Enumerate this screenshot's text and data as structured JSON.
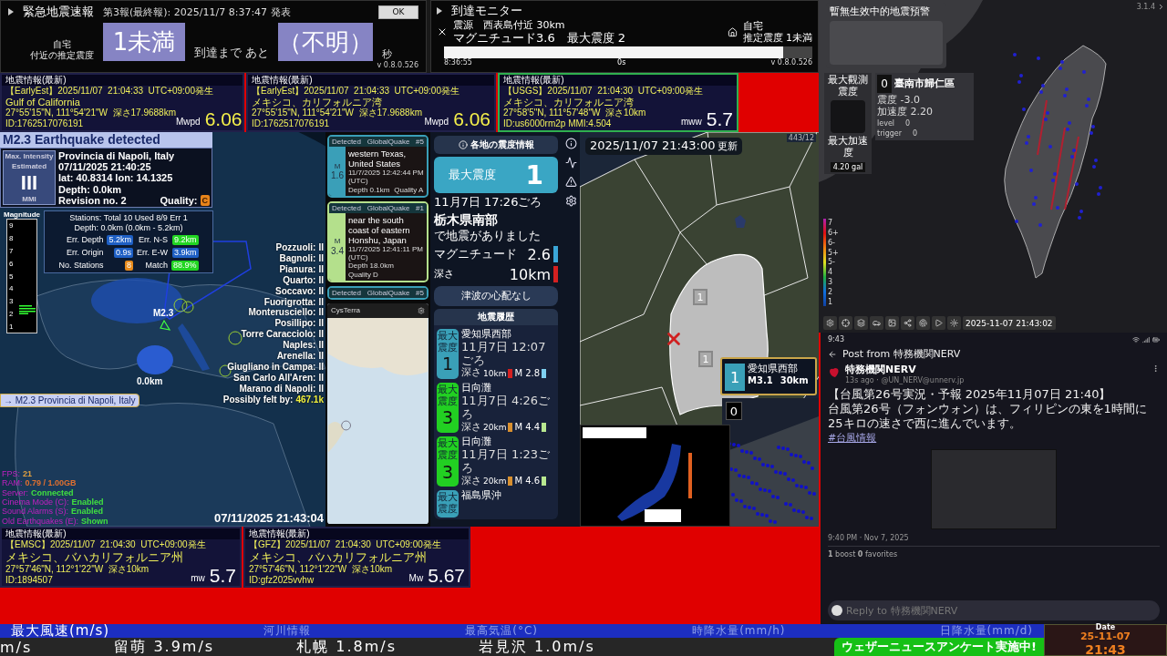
{
  "eew": {
    "title": "緊急地震速報",
    "report": "第3報(最終報): 2025/11/7 8:37:47 発表",
    "ok": "OK",
    "location": [
      "自宅",
      "付近の推定震度"
    ],
    "intensity": "1未満",
    "until": "到達まで あと",
    "seconds": "（不明）",
    "unit": "秒",
    "version": "v 0.8.0.526"
  },
  "monitor": {
    "title": "到達モニター",
    "epicenter": "震源　西表島付近 30km",
    "magnitude": "マグニチュード3.6　最大震度 2",
    "home": "自宅",
    "home_intensity": "推定震度 1未満",
    "countdown": "0s",
    "level": 0.92,
    "time": "8:36:55",
    "version": "v 0.8.0.526"
  },
  "quake_cards": [
    {
      "heading": "地震情報(最新)",
      "source": "【EarlyEst】2025/11/07  21:04:33  UTC+09:00発生",
      "region": "Gulf of California",
      "coords": "27°55'15\"N, 111°54'21\"W  深さ17.9688km",
      "id": "ID:1762517076191",
      "mag_type": "Mwpd",
      "mag": "6.06",
      "color": "#f5f04a",
      "highlighted": false
    },
    {
      "heading": "地震情報(最新)",
      "source": "【EarlyEst】2025/11/07  21:04:33  UTC+09:00発生",
      "region": "メキシコ、カリフォルニア湾",
      "coords": "27°55'15\"N, 111°54'21\"W  深さ17.9688km",
      "id": "ID:1762517076191",
      "mag_type": "Mwpd",
      "mag": "6.06",
      "color": "#f5f04a",
      "highlighted": false
    },
    {
      "heading": "地震情報(最新)",
      "source": "【USGS】2025/11/07  21:04:30  UTC+09:00発生",
      "region": "メキシコ、カリフォルニア湾",
      "coords": "27°58'5\"N, 111°57'48\"W  深さ10km",
      "id": "ID:us6000rm2p MMI:4.504",
      "mag_type": "mww",
      "mag": "5.7",
      "color": "#ffffff",
      "highlighted": true
    }
  ],
  "globe": {
    "banner": "M2.3 Earthquake detected",
    "intensity_label": [
      "Max. Intensity",
      "Estimated"
    ],
    "intensity": "III",
    "intensity_unit": "MMI",
    "place": "Provincia di Napoli, Italy",
    "time": "07/11/2025 21:40:25",
    "coords": "lat: 40.8314 lon: 14.1325",
    "depth": "Depth: 0.0km",
    "revision": "Revision no. 2",
    "quality_label": "Quality:",
    "quality": "C",
    "magnitude_title": "Magnitude",
    "magnitude_ticks": [
      "9",
      "8",
      "7",
      "6",
      "5",
      "4",
      "3",
      "2",
      "1"
    ],
    "stations_summary": "Stations: Total 10 Used 8/9 Err 1",
    "depth_range": "Depth: 0.0km (0.0km - 5.2km)",
    "stats": [
      {
        "label": "Err. Depth",
        "value": "5.2km",
        "color": "#1e5fc4"
      },
      {
        "label": "Err. N-S",
        "value": "9.2km",
        "color": "#22d622"
      },
      {
        "label": "Err. Origin",
        "value": "0.9s",
        "color": "#1e5fc4"
      },
      {
        "label": "Err. E-W",
        "value": "3.9km",
        "color": "#1e5fc4"
      },
      {
        "label": "No. Stations",
        "value": "8",
        "color": "#e88a1a"
      },
      {
        "label": "Match",
        "value": "88.9%",
        "color": "#22d622"
      }
    ],
    "marker": "M2.3",
    "marker_depth": "0.0km",
    "cities": [
      {
        "name": "Pozzuoli:",
        "intensity": "II"
      },
      {
        "name": "Bagnoli:",
        "intensity": "II"
      },
      {
        "name": "Pianura:",
        "intensity": "II"
      },
      {
        "name": "Quarto:",
        "intensity": "II"
      },
      {
        "name": "Soccavo:",
        "intensity": "II"
      },
      {
        "name": "Fuorigrotta:",
        "intensity": "II"
      },
      {
        "name": "Monterusciello:",
        "intensity": "II"
      },
      {
        "name": "Posillipo:",
        "intensity": "II"
      },
      {
        "name": "Torre Caracciolo:",
        "intensity": "II"
      },
      {
        "name": "Naples:",
        "intensity": "II"
      },
      {
        "name": "Arenella:",
        "intensity": "II"
      },
      {
        "name": "Giugliano in Campa:",
        "intensity": "II"
      },
      {
        "name": "San Carlo All'Aren:",
        "intensity": "II"
      },
      {
        "name": "Marano di Napoli:",
        "intensity": "II"
      }
    ],
    "felt_label": "Possibly felt by:",
    "felt": "467.1k",
    "list_item": "→ M2.3 Provincia di Napoli, Italy",
    "status": [
      {
        "label": "FPS:",
        "value": "21",
        "color": "#e0a040"
      },
      {
        "label": "RAM:",
        "value": "0.79 / 1.00GB",
        "color": "#e07030"
      },
      {
        "label": "Server:",
        "value": "Connected",
        "color": "#40e040"
      },
      {
        "label": "Cinema Mode (C):",
        "value": "Enabled",
        "color": "#40e040"
      },
      {
        "label": "Sound Alarms (S):",
        "value": "Enabled",
        "color": "#40e040"
      },
      {
        "label": "Old Earthquakes (E):",
        "value": "Shown",
        "color": "#40e040"
      }
    ],
    "clock": "07/11/2025 21:43:04"
  },
  "gq_cards": [
    {
      "status": "Detected",
      "source": "GlobalQuake",
      "number": "#5",
      "m": "M",
      "mag": "1.6",
      "place": "western Texas, United States",
      "time": "11/7/2025 12:42:44 PM (UTC)",
      "depth": "Depth 0.1km",
      "quality": "Quality A",
      "color": "#3a9fb8"
    },
    {
      "status": "Detected",
      "source": "GlobalQuake",
      "number": "#1",
      "m": "M",
      "mag": "3.4",
      "place": "near the south coast of eastern Honshu, Japan",
      "time": "11/7/2025 12:41:11 PM (UTC)",
      "depth": "Depth 18.0km",
      "quality": "Quality D",
      "color": "#b4e08c"
    }
  ],
  "gq_partial": {
    "status": "Detected",
    "source": "GlobalQuake",
    "number": "#5",
    "color": "#3a9fb8"
  },
  "cysterra": {
    "title": "CysTerra"
  },
  "info": {
    "title": "各地の震度情報",
    "max_label": "最大震度",
    "max": "1",
    "time": "11月7日 17:26ごろ",
    "region": "栃木県南部",
    "note": "で地震がありました",
    "magnitude": {
      "label": "マグニチュード",
      "value": "2.6",
      "color": "#3aa6d8"
    },
    "depth": {
      "label": "深さ",
      "value": "10km",
      "color": "#d42020"
    },
    "tsunami": "津波の心配なし",
    "history_title": "地震履歴",
    "history": [
      {
        "badge_label": "最大震度",
        "intensity": "1",
        "color": "#3aa0b8",
        "region": "愛知県西部",
        "time": "11月7日 12:07ごろ",
        "depth_label": "深さ",
        "depth": {
          "value": "10km",
          "color": "#d42020"
        },
        "mag": {
          "value": "M 2.8",
          "color": "#7fd0f0"
        }
      },
      {
        "badge_label": "最大震度",
        "intensity": "3",
        "color": "#22d022",
        "region": "日向灘",
        "time": "11月7日 4:26ごろ",
        "depth_label": "深さ",
        "depth": {
          "value": "20km",
          "color": "#d89030"
        },
        "mag": {
          "value": "M 4.4",
          "color": "#b8e890"
        }
      },
      {
        "badge_label": "最大震度",
        "intensity": "3",
        "color": "#22d022",
        "region": "日向灘",
        "time": "11月7日 1:23ごろ",
        "depth_label": "深さ",
        "depth": {
          "value": "20km",
          "color": "#d89030"
        },
        "mag": {
          "value": "M 4.6",
          "color": "#b8e890"
        }
      },
      {
        "badge_label": "最大震度",
        "color": "#3aa0b8",
        "region": "福島県沖"
      }
    ]
  },
  "map": {
    "updated": "2025/11/07 21:43:00",
    "updated_suffix": "更新",
    "markers": [
      "1",
      "1"
    ],
    "counter": "443/12",
    "latest": {
      "intensity": "1",
      "region": "愛知県西部",
      "mag": "M3.1",
      "depth": "30km"
    },
    "station_value": "0"
  },
  "bottom_cards": [
    {
      "heading": "地震情報(最新)",
      "source": "【EMSC】2025/11/07  21:04:30  UTC+09:00発生",
      "region": "メキシコ、バハカリフォルニア州",
      "coords": "27°57'46\"N, 112°1'22\"W  深さ10km",
      "id": "ID:1894507",
      "mag_type": "mw",
      "mag": "5.7",
      "color": "#ffffff",
      "highlighted": false
    },
    {
      "heading": "地震情報(最新)",
      "source": "【GFZ】2025/11/07  21:04:30  UTC+09:00発生",
      "region": "メキシコ、バハカリフォルニア州",
      "coords": "27°57'46\"N, 112°1'22\"W  深さ10km",
      "id": "ID:gfz2025vvhw",
      "mag_type": "Mw",
      "mag": "5.67",
      "color": "#ffffff",
      "highlighted": false
    }
  ],
  "taiwan": {
    "alert_title": "暫無生效中的地震預警",
    "max_label": "最大觀測震度",
    "intensity": "0",
    "location": "臺南市歸仁區",
    "shindo": "震度 -3.0",
    "accel": "加速度 2.20",
    "rows": [
      {
        "label": "level",
        "value": "0"
      },
      {
        "label": "trigger",
        "value": "0"
      }
    ],
    "max_accel_label": "最大加速度",
    "max_accel": "4.20 gal",
    "version": "3.1.4",
    "scale": [
      "7",
      "6+",
      "6-",
      "5+",
      "5-",
      "4",
      "3",
      "2",
      "1"
    ],
    "time": "2025-11-07 21:43:02"
  },
  "nerv": {
    "status_time": "9:43",
    "title": "Post from 特務機関NERV",
    "author": "特務機関NERV",
    "meta": "13s ago · @UN_NERV@unnerv.jp",
    "lines": [
      "【台風第26号実況・予報 2025年11月07日 21:40】",
      "台風第26号（フォンウォン）は、フィリピンの東を1時間に25キロの速さで西に進んでいます。"
    ],
    "hashtag": "#台風情報",
    "date": "9:40 PM · Nov 7, 2025",
    "stats": "**1** boost **0** favorites",
    "reply_placeholder": "Reply to 特務機関NERV"
  },
  "ticker": {
    "headers": [
      "最大風速(m/s)",
      "河川情報",
      "最高気温(°C)",
      "時降水量(mm/h)",
      "日降水量(mm/d)"
    ],
    "values": [
      "m/s",
      "留萌 3.9m/s",
      "札幌 1.8m/s",
      "岩見沢 1.0m/s"
    ],
    "banner": "ウェザーニュースアンケート実施中!",
    "date_label": "Date",
    "date": "25-11-07",
    "time": "21:43"
  }
}
